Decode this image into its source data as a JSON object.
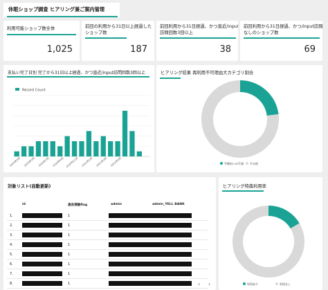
{
  "header": {
    "title": "休眠ショップ調査 ヒアリング兼ご案内管理"
  },
  "kpis": [
    {
      "label": "利用可能ショップ数全体",
      "value": "1,025"
    },
    {
      "label_line1": "前回の利用から31日以上経過した",
      "label_line2": "ショップ数",
      "value": "187"
    },
    {
      "label_line1": "前回利用から31日経過、かつ直近/input",
      "label_line2": "訪問回数3回以上",
      "value": "38"
    },
    {
      "label_line1": "前回利用から31日経過、かつ/input訪問",
      "label_line2": "なしのショップ数",
      "value": "69"
    }
  ],
  "bar_section": {
    "title": "支払い完了日別 完了から31日以上経過、かつ直近/input訪問回数3回以上",
    "legend": "Record Count"
  },
  "donut1": {
    "title": "ヒアリング結果 再利用不可理由大カテゴリ割合",
    "pct_label": "23%",
    "legend": [
      "手数料への不満",
      "その他"
    ]
  },
  "table_section": {
    "title": "対象リスト(自動更新)",
    "columns": [
      "id",
      "過去接触flag",
      "admin",
      "admin_YELL BANK"
    ],
    "rows": [
      {
        "idx": "1.",
        "flag": "1"
      },
      {
        "idx": "2.",
        "flag": "1"
      },
      {
        "idx": "3.",
        "flag": "1"
      },
      {
        "idx": "4.",
        "flag": "1"
      },
      {
        "idx": "5.",
        "flag": "1"
      },
      {
        "idx": "6.",
        "flag": "1"
      },
      {
        "idx": "7.",
        "flag": "1"
      },
      {
        "idx": "8.",
        "flag": "1"
      }
    ],
    "pager_prev": "‹",
    "pager_next": "›"
  },
  "donut2": {
    "title": "ヒアリング特典利用率",
    "pct_label": "16.5%",
    "legend": [
      "利用あり",
      "利用なし"
    ]
  },
  "colors": {
    "accent": "#1aa394",
    "muted": "#d9d9d9"
  },
  "chart_data": [
    {
      "type": "bar",
      "title": "支払い完了日別 完了から31日以上経過、かつ直近/input訪問回数3回以上",
      "legend": [
        "Record Count"
      ],
      "categories": [
        "2020年3月",
        "",
        "2020年5月",
        "",
        "",
        "",
        "2020年9月",
        "",
        "2020年11月",
        "",
        "2021年1月",
        "",
        "2021年3月",
        "",
        "2021年5月",
        "",
        "",
        "",
        ""
      ],
      "tick_labels": [
        "2020年3月",
        "2020年5月",
        "2020年7月",
        "2020年9月",
        "2020年11月",
        "2021年1月",
        "2021年3月",
        "2021年5月"
      ],
      "series": [
        {
          "name": "Record Count",
          "values": [
            1,
            2,
            2,
            3,
            3,
            3,
            2,
            4,
            3,
            3,
            5,
            3,
            4,
            3,
            3,
            9,
            5,
            1,
            0
          ]
        }
      ],
      "ylim": [
        0,
        12
      ],
      "grid": true,
      "legend_position": "top-left"
    },
    {
      "type": "pie",
      "title": "ヒアリング結果 再利用不可理由大カテゴリ割合",
      "categories": [
        "手数料への不満",
        "その他"
      ],
      "values": [
        23,
        77
      ]
    },
    {
      "type": "pie",
      "title": "ヒアリング特典利用率",
      "categories": [
        "利用あり",
        "利用なし"
      ],
      "values": [
        16.5,
        83.5
      ]
    }
  ]
}
